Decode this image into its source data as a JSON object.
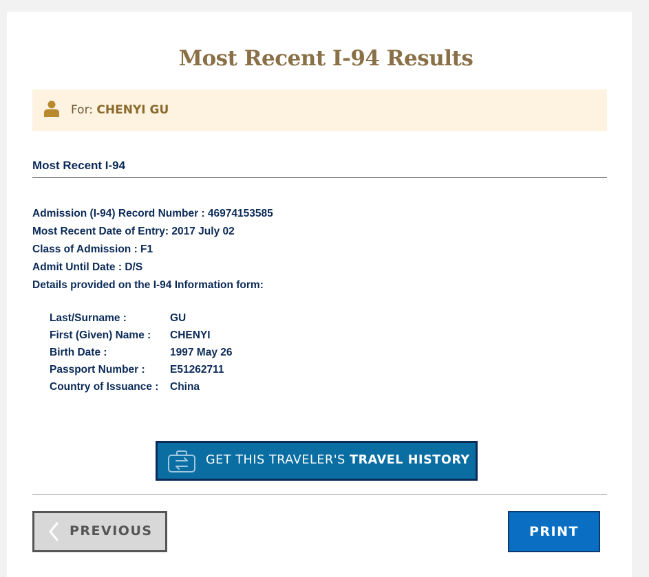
{
  "page": {
    "title": "Most Recent I-94 Results"
  },
  "traveler": {
    "for_label": "For:",
    "name": "CHENYI GU"
  },
  "section": {
    "heading": "Most Recent I-94"
  },
  "record": {
    "lines": [
      "Admission (I-94) Record Number : 46974153585",
      "Most Recent Date of Entry: 2017 July 02",
      "Class of Admission : F1",
      "Admit Until Date : D/S",
      "Details provided on the I-94 Information form:"
    ]
  },
  "details": [
    {
      "label": "Last/Surname :",
      "value": "GU"
    },
    {
      "label": "First (Given) Name :",
      "value": "CHENYI"
    },
    {
      "label": "Birth Date :",
      "value": "1997 May 26"
    },
    {
      "label": "Passport Number :",
      "value": "E51262711"
    },
    {
      "label": "Country of Issuance :",
      "value": "China"
    }
  ],
  "actions": {
    "history_prefix": "GET THIS TRAVELER'S",
    "history_bold": "TRAVEL HISTORY",
    "previous_label": "PREVIOUS",
    "print_label": "PRINT"
  },
  "colors": {
    "title": "#8a7046",
    "banner_bg": "#fdf3e0",
    "navy_text": "#0b2a57",
    "history_button": "#0a6ea3",
    "print_button": "#0a6fc2"
  },
  "icons": {
    "user": "user-icon",
    "suitcase": "suitcase-icon",
    "chevron": "chevron-left-icon"
  }
}
